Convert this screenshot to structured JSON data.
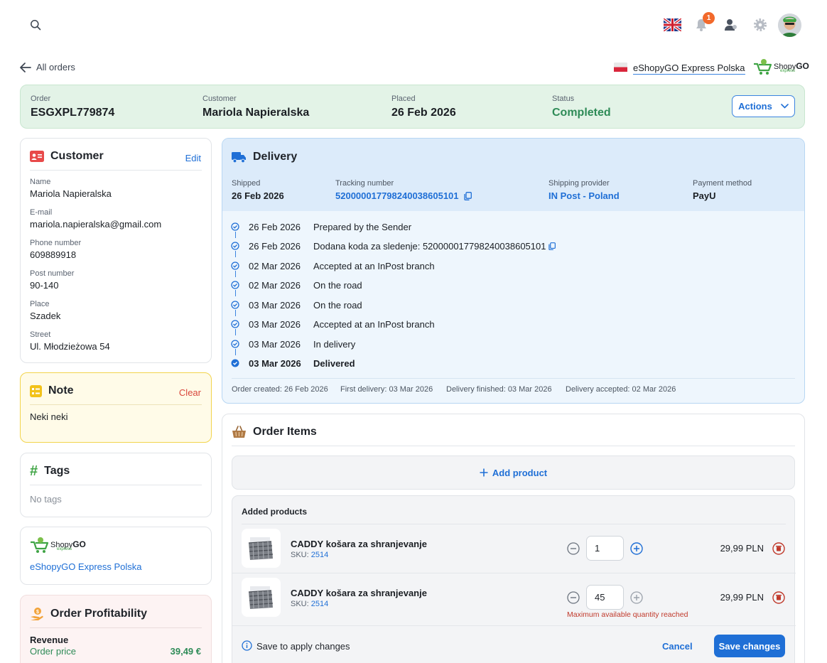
{
  "header": {
    "notification_count": "1"
  },
  "breadcrumb": {
    "back_label": "All orders",
    "store_name": "eShopyGO Express Polska",
    "logo_text_a": "Shopy",
    "logo_text_b": "GO",
    "logo_sub": "express"
  },
  "order": {
    "order_label": "Order",
    "order_id": "ESGXPL779874",
    "customer_label": "Customer",
    "customer_name": "Mariola Napieralska",
    "placed_label": "Placed",
    "placed_date": "26 Feb 2026",
    "status_label": "Status",
    "status": "Completed",
    "status_color": "#2e8b57",
    "actions_label": "Actions"
  },
  "customer_card": {
    "title": "Customer",
    "edit_label": "Edit",
    "fields": [
      {
        "label": "Name",
        "value": "Mariola Napieralska"
      },
      {
        "label": "E-mail",
        "value": "mariola.napieralska@gmail.com"
      },
      {
        "label": "Phone number",
        "value": "609889918"
      },
      {
        "label": "Post number",
        "value": "90-140"
      },
      {
        "label": "Place",
        "value": "Szadek"
      },
      {
        "label": "Street",
        "value": "Ul. Młodzieżowa 54"
      }
    ]
  },
  "note_card": {
    "title": "Note",
    "clear_label": "Clear",
    "text": "Neki neki"
  },
  "tags_card": {
    "title": "Tags",
    "empty_text": "No tags"
  },
  "store_card": {
    "store_link": "eShopyGO Express Polska"
  },
  "profit_card": {
    "title": "Order Profitability",
    "revenue_label": "Revenue",
    "order_price_label": "Order price",
    "order_price_value": "39,49 €"
  },
  "delivery": {
    "title": "Delivery",
    "shipped_label": "Shipped",
    "shipped_value": "26 Feb 2026",
    "tracking_label": "Tracking number",
    "tracking_value": "520000017798240038605101",
    "provider_label": "Shipping provider",
    "provider_value": "IN Post - Poland",
    "payment_label": "Payment method",
    "payment_value": "PayU",
    "timeline": [
      {
        "date": "26 Feb 2026",
        "text": "Prepared by the Sender"
      },
      {
        "date": "26 Feb 2026",
        "text": "Dodana koda za sledenje: 520000017798240038605101"
      },
      {
        "date": "02 Mar 2026",
        "text": "Accepted at an InPost branch"
      },
      {
        "date": "02 Mar 2026",
        "text": "On the road"
      },
      {
        "date": "03 Mar 2026",
        "text": "On the road"
      },
      {
        "date": "03 Mar 2026",
        "text": "Accepted at an InPost branch"
      },
      {
        "date": "03 Mar 2026",
        "text": "In delivery"
      },
      {
        "date": "03 Mar 2026",
        "text": "Delivered"
      }
    ],
    "footer": {
      "created": "Order created: 26 Feb 2026",
      "first_delivery": "First delivery: 03 Mar 2026",
      "finished": "Delivery finished: 03 Mar 2026",
      "accepted": "Delivery accepted: 02 Mar 2026"
    }
  },
  "order_items": {
    "title": "Order Items",
    "add_product_label": "Add product",
    "added_products_label": "Added products",
    "products": [
      {
        "name": "CADDY košara za shranjevanje",
        "sku_label": "SKU:",
        "sku": "2514",
        "qty": "1",
        "price": "29,99 PLN"
      },
      {
        "name": "CADDY košara za shranjevanje",
        "sku_label": "SKU:",
        "sku": "2514",
        "qty": "45",
        "price": "29,99 PLN"
      }
    ],
    "max_qty_warning": "Maximum available quantity reached",
    "save_hint": "Save to apply changes",
    "cancel_label": "Cancel",
    "save_label": "Save changes"
  }
}
